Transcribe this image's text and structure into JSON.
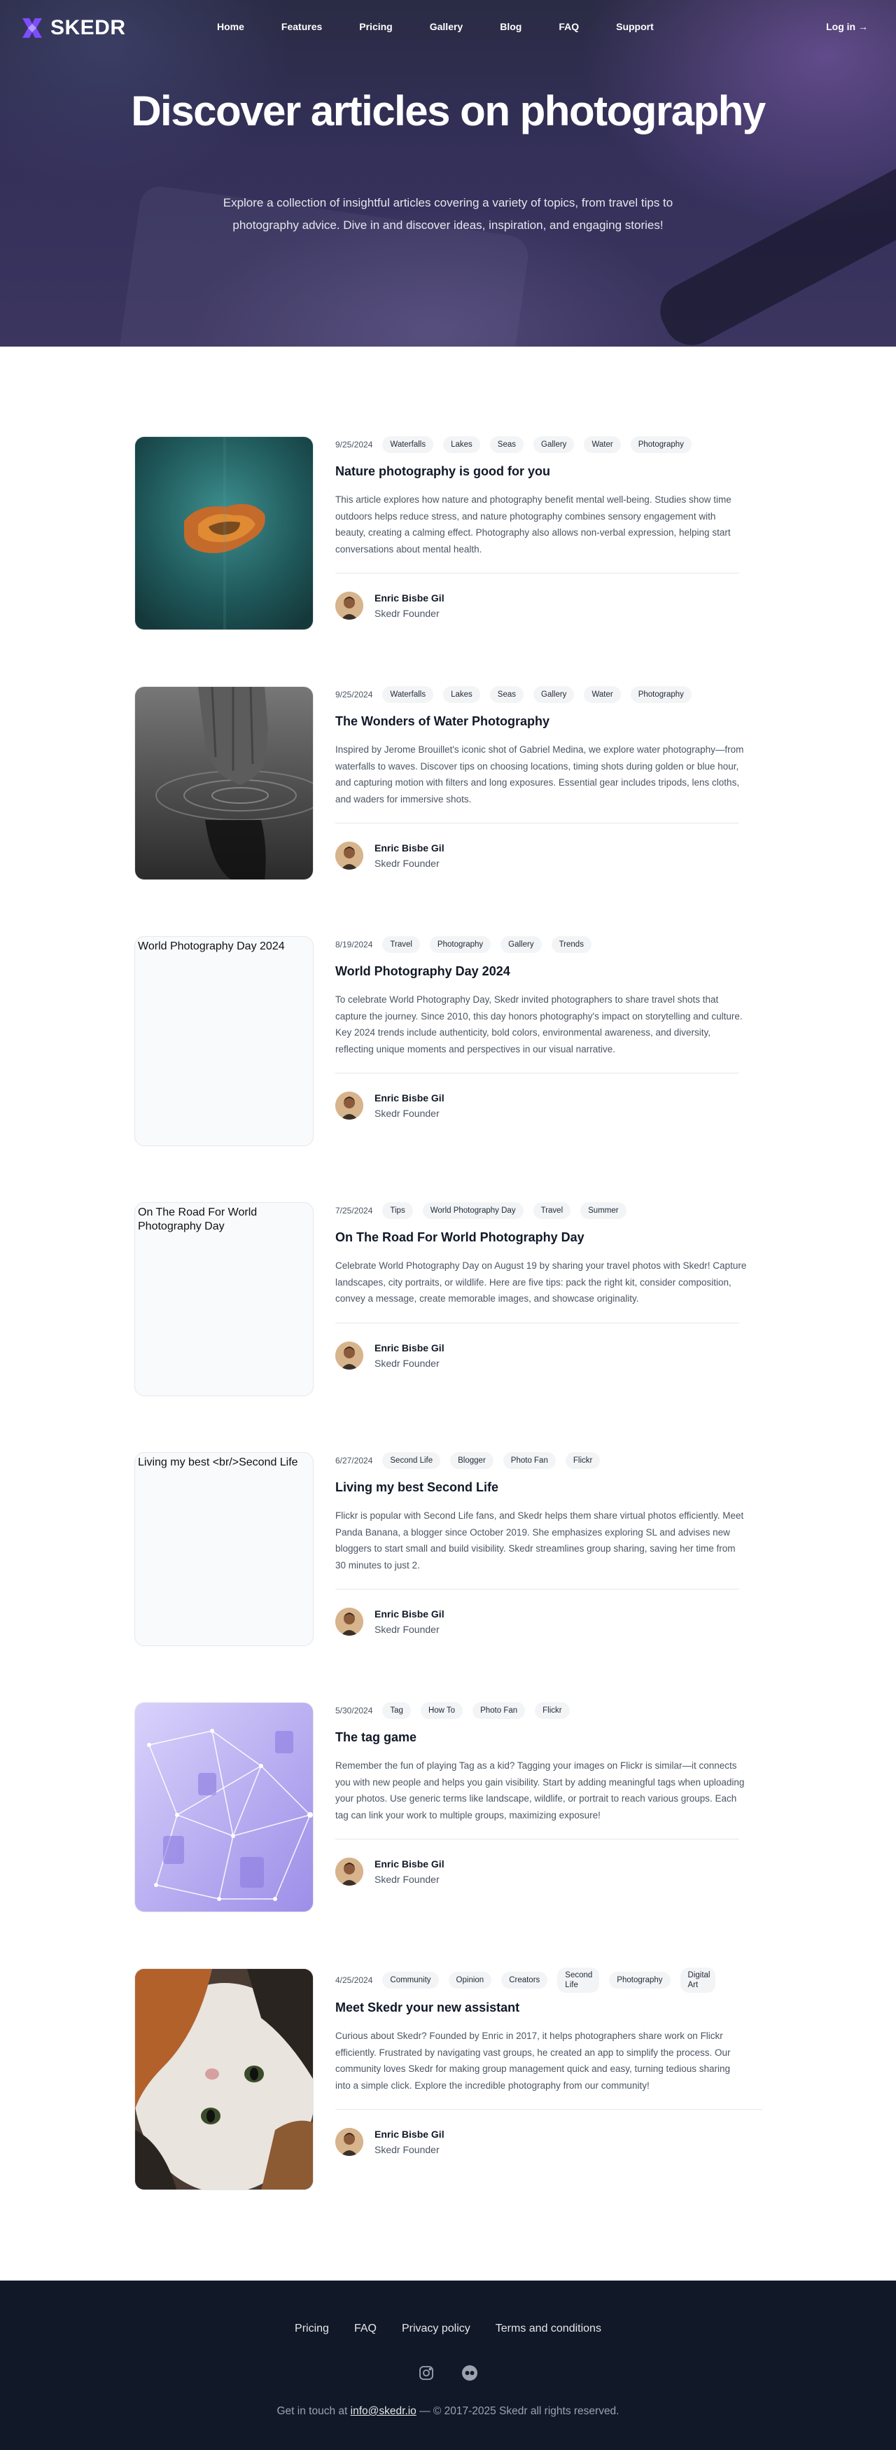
{
  "brand": {
    "name": "SKEDR"
  },
  "nav": {
    "items": [
      "Home",
      "Features",
      "Pricing",
      "Gallery",
      "Blog",
      "FAQ",
      "Support"
    ],
    "login": "Log in →"
  },
  "hero": {
    "title": "Discover articles on photography",
    "subtitle": "Explore a collection of insightful articles covering a variety of topics, from travel tips to photography advice. Dive in and discover ideas, inspiration, and engaging stories!"
  },
  "articles": [
    {
      "date": "9/25/2024",
      "tags": [
        "Waterfalls",
        "Lakes",
        "Seas",
        "Gallery",
        "Water",
        "Photography"
      ],
      "title": "Nature photography is good for you",
      "body": "This article explores how nature and photography benefit mental well-being. Studies show time outdoors helps reduce stress, and nature photography combines sensory engagement with beauty, creating a calming effect. Photography also allows non-verbal expression, helping start conversations about mental health.",
      "author": "Enric Bisbe Gil",
      "role": "Skedr Founder",
      "image": "island-aerial"
    },
    {
      "date": "9/25/2024",
      "tags": [
        "Waterfalls",
        "Lakes",
        "Seas",
        "Gallery",
        "Water",
        "Photography"
      ],
      "title": "The Wonders of Water Photography",
      "body": "Inspired by Jerome Brouillet's iconic shot of Gabriel Medina, we explore water photography—from waterfalls to waves. Discover tips on choosing locations, timing shots during golden or blue hour, and capturing motion with filters and long exposures. Essential gear includes tripods, lens cloths, and waders for immersive shots.",
      "author": "Enric Bisbe Gil",
      "role": "Skedr Founder",
      "image": "hand-water"
    },
    {
      "date": "8/19/2024",
      "tags": [
        "Travel",
        "Photography",
        "Gallery",
        "Trends"
      ],
      "title": "World Photography Day 2024",
      "body": "To celebrate World Photography Day, Skedr invited photographers to share travel shots that capture the journey. Since 2010, this day honors photography's impact on storytelling and culture. Key 2024 trends include authenticity, bold colors, environmental awareness, and diversity, reflecting unique moments and perspectives in our visual narrative.",
      "author": "Enric Bisbe Gil",
      "role": "Skedr Founder",
      "alt": "World Photography Day 2024"
    },
    {
      "date": "7/25/2024",
      "tags": [
        "Tips",
        "World Photography Day",
        "Travel",
        "Summer"
      ],
      "title": "On The Road For World Photography Day",
      "body": "Celebrate World Photography Day on August 19 by sharing your travel photos with Skedr! Capture landscapes, city portraits, or wildlife. Here are five tips: pack the right kit, consider composition, convey a message, create memorable images, and showcase originality.",
      "author": "Enric Bisbe Gil",
      "role": "Skedr Founder",
      "alt": "On The Road For World Photography Day"
    },
    {
      "date": "6/27/2024",
      "tags": [
        "Second Life",
        "Blogger",
        "Photo Fan",
        "Flickr"
      ],
      "title": "Living my best Second Life",
      "body": "Flickr is popular with Second Life fans, and Skedr helps them share virtual photos efficiently. Meet Panda Banana, a blogger since October 2019. She emphasizes exploring SL and advises new bloggers to start small and build visibility. Skedr streamlines group sharing, saving her time from 30 minutes to just 2.",
      "author": "Enric Bisbe Gil",
      "role": "Skedr Founder",
      "alt": "Living my best <br/>Second Life"
    },
    {
      "date": "5/30/2024",
      "tags": [
        "Tag",
        "How To",
        "Photo Fan",
        "Flickr"
      ],
      "title": "The tag game",
      "body": "Remember the fun of playing Tag as a kid? Tagging your images on Flickr is similar—it connects you with new people and helps you gain visibility. Start by adding meaningful tags when uploading your photos. Use generic terms like landscape, wildlife, or portrait to reach various groups. Each tag can link your work to multiple groups, maximizing exposure!",
      "author": "Enric Bisbe Gil",
      "role": "Skedr Founder",
      "image": "purple-network"
    },
    {
      "date": "4/25/2024",
      "tags": [
        "Community",
        "Opinion",
        "Creators",
        "Second Life",
        "Photography",
        "Digital Art"
      ],
      "title": "Meet Skedr your new assistant",
      "body": "Curious about Skedr? Founded by Enric in 2017, it helps photographers share work on Flickr efficiently. Frustrated by navigating vast groups, he created an app to simplify the process. Our community loves Skedr for making group management quick and easy, turning tedious sharing into a simple click. Explore the incredible photography from our community!",
      "author": "Enric Bisbe Gil",
      "role": "Skedr Founder",
      "image": "cat-portrait"
    }
  ],
  "footer": {
    "links": [
      "Pricing",
      "FAQ",
      "Privacy policy",
      "Terms and conditions"
    ],
    "icons": [
      "instagram-icon",
      "flickr-icon"
    ],
    "contact_prefix": "Get in touch at",
    "email": "info@skedr.io",
    "copyright": "— © 2017-2025 Skedr all rights reserved."
  }
}
